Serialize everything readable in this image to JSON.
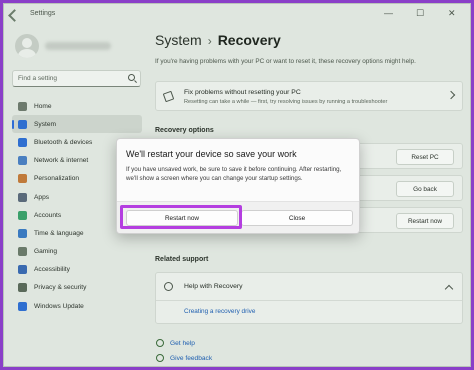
{
  "window": {
    "title": "Settings",
    "controls": [
      "—",
      "☐",
      "✕"
    ]
  },
  "sidebar": {
    "search_placeholder": "Find a setting",
    "items": [
      {
        "label": "Home",
        "icon": "home-icon",
        "color": "#6d7a6d",
        "active": false
      },
      {
        "label": "System",
        "icon": "monitor-icon",
        "color": "#2f6fd0",
        "active": true
      },
      {
        "label": "Bluetooth & devices",
        "icon": "bluetooth-icon",
        "color": "#2f6fd0",
        "active": false
      },
      {
        "label": "Network & internet",
        "icon": "wifi-icon",
        "color": "#4a7fc0",
        "active": false
      },
      {
        "label": "Personalization",
        "icon": "brush-icon",
        "color": "#c07a3a",
        "active": false
      },
      {
        "label": "Apps",
        "icon": "apps-icon",
        "color": "#5a6a7a",
        "active": false
      },
      {
        "label": "Accounts",
        "icon": "person-icon",
        "color": "#3aa06a",
        "active": false
      },
      {
        "label": "Time & language",
        "icon": "globe-clock-icon",
        "color": "#3a7ac0",
        "active": false
      },
      {
        "label": "Gaming",
        "icon": "gamepad-icon",
        "color": "#6a7a6a",
        "active": false
      },
      {
        "label": "Accessibility",
        "icon": "accessibility-icon",
        "color": "#3a6ab0",
        "active": false
      },
      {
        "label": "Privacy & security",
        "icon": "shield-icon",
        "color": "#5a6a5a",
        "active": false
      },
      {
        "label": "Windows Update",
        "icon": "update-icon",
        "color": "#2f6fd0",
        "active": false
      }
    ]
  },
  "main": {
    "breadcrumb_parent": "System",
    "breadcrumb_sep": "›",
    "breadcrumb_current": "Recovery",
    "intro": "If you're having problems with your PC or want to reset it, these recovery options might help.",
    "fix_card": {
      "title": "Fix problems without resetting your PC",
      "subtitle": "Resetting can take a while — first, try resolving issues by running a troubleshooter"
    },
    "recovery_options_heading": "Recovery options",
    "options": [
      {
        "button": "Reset PC"
      },
      {
        "button": "Go back"
      },
      {
        "button": "Restart now"
      }
    ],
    "related_support_heading": "Related support",
    "help": {
      "title": "Help with Recovery",
      "link": "Creating a recovery drive"
    },
    "footer_links": [
      "Get help",
      "Give feedback"
    ]
  },
  "dialog": {
    "title": "We'll restart your device so save your work",
    "body": "If you have unsaved work, be sure to save it before continuing. After restarting, we'll show a screen where you can change your startup settings.",
    "primary_button": "Restart now",
    "secondary_button": "Close",
    "highlight_color": "#b43ee0"
  }
}
